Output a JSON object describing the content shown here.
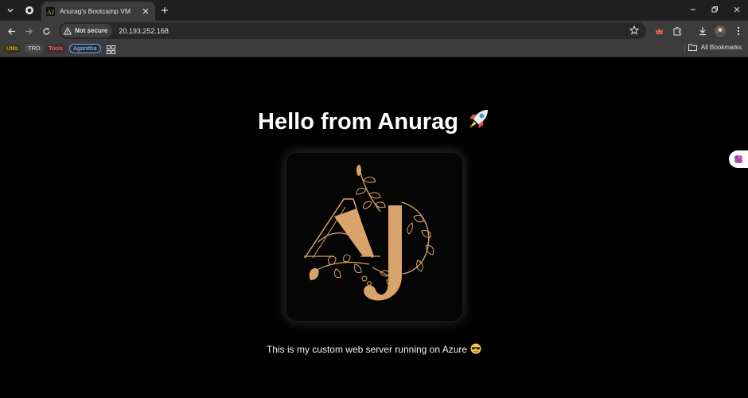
{
  "browser": {
    "tab_title": "Anurag's Bootcamp VM",
    "security_label": "Not secure",
    "url": "20.193.252.168",
    "bookmarks": [
      {
        "label": "Utils",
        "bg": "#3b3418",
        "fg": "#f0c84a"
      },
      {
        "label": "TRD",
        "bg": "#4a4a4a",
        "fg": "#e3e3e3"
      },
      {
        "label": "Tools",
        "bg": "#4a2a2a",
        "fg": "#f28b82"
      },
      {
        "label": "Aganitha",
        "bg": "#203040",
        "fg": "#a8c7fa"
      }
    ],
    "all_bookmarks_label": "All Bookmarks",
    "icons": [
      "tab-search-icon",
      "back-icon",
      "forward-icon",
      "reload-icon",
      "warning-icon",
      "star-icon",
      "extensions-icon",
      "download-icon",
      "profile-icon",
      "menu-icon",
      "apps-grid-icon",
      "folder-icon"
    ]
  },
  "page": {
    "heading": "Hello from Anurag",
    "heading_emoji": "🚀",
    "logo_initials": "AJ",
    "caption": "This is my custom web server running on Azure",
    "caption_emoji": "😎"
  },
  "colors": {
    "logo_gold": "#d9a46a",
    "page_bg": "#000000",
    "chrome_bg": "#3c3c3c"
  }
}
